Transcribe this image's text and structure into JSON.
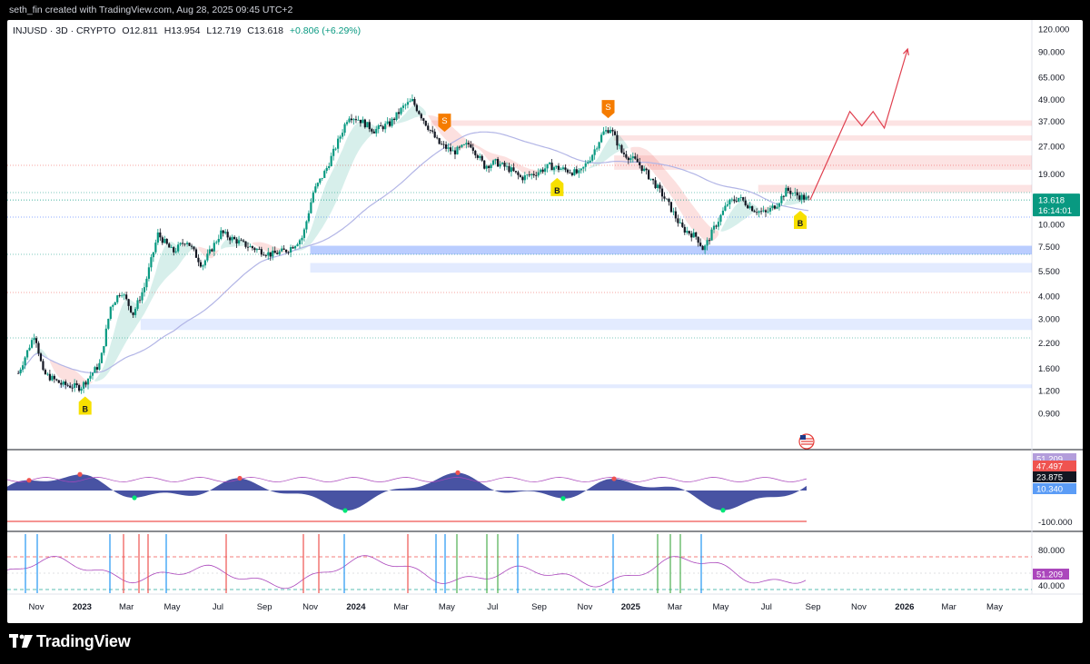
{
  "header": {
    "caption": "seth_fin created with TradingView.com, Aug 28, 2025 09:45 UTC+2"
  },
  "legend": {
    "symbol": "INJUSD · 3D · CRYPTO",
    "open": "O12.811",
    "high": "H13.954",
    "low": "L12.719",
    "close": "C13.618",
    "change": "+0.806 (+6.29%)"
  },
  "footer": {
    "brand": "TradingView"
  },
  "chart_data": [
    {
      "type": "candlestick",
      "symbol": "INJUSD",
      "interval": "3D",
      "scale": "log",
      "y_ticks": [
        "120.000",
        "90.000",
        "65.000",
        "49.000",
        "37.000",
        "27.000",
        "19.000",
        "10.000",
        "7.500",
        "5.500",
        "4.000",
        "3.000",
        "2.200",
        "1.600",
        "1.200",
        "0.900"
      ],
      "y_tick_values": [
        120,
        90,
        65,
        49,
        37,
        27,
        19,
        10,
        7.5,
        5.5,
        4,
        3,
        2.2,
        1.6,
        1.2,
        0.9
      ],
      "x_ticks": [
        "Nov",
        "2023",
        "Mar",
        "May",
        "Jul",
        "Sep",
        "Nov",
        "2024",
        "Mar",
        "May",
        "Jul",
        "Sep",
        "Nov",
        "2025",
        "Mar",
        "May",
        "Jul",
        "Sep",
        "Nov",
        "2026",
        "Mar",
        "May"
      ],
      "x_tick_dates": [
        "2022-11-01",
        "2023-01-01",
        "2023-03-01",
        "2023-05-01",
        "2023-07-01",
        "2023-09-01",
        "2023-11-01",
        "2024-01-01",
        "2024-03-01",
        "2024-05-01",
        "2024-07-01",
        "2024-09-01",
        "2024-11-01",
        "2025-01-01",
        "2025-03-01",
        "2025-05-01",
        "2025-07-01",
        "2025-09-01",
        "2025-11-01",
        "2026-01-01",
        "2026-03-01",
        "2026-05-01"
      ],
      "last_price": "13.618",
      "countdown": "16:14:01",
      "price_path": [
        [
          "2022-10-08",
          1.5
        ],
        [
          "2022-10-30",
          2.5
        ],
        [
          "2022-11-10",
          1.5
        ],
        [
          "2022-12-05",
          1.3
        ],
        [
          "2022-12-30",
          1.25
        ],
        [
          "2023-01-25",
          1.7
        ],
        [
          "2023-02-08",
          3.5
        ],
        [
          "2023-02-22",
          4.3
        ],
        [
          "2023-03-10",
          3.2
        ],
        [
          "2023-03-25",
          4.5
        ],
        [
          "2023-04-12",
          8.8
        ],
        [
          "2023-05-02",
          7.0
        ],
        [
          "2023-05-20",
          8.2
        ],
        [
          "2023-06-10",
          5.9
        ],
        [
          "2023-07-05",
          9.0
        ],
        [
          "2023-07-20",
          8.3
        ],
        [
          "2023-08-12",
          7.5
        ],
        [
          "2023-09-10",
          6.8
        ],
        [
          "2023-10-02",
          7.2
        ],
        [
          "2023-10-22",
          8.5
        ],
        [
          "2023-11-05",
          15
        ],
        [
          "2023-11-22",
          20
        ],
        [
          "2023-12-10",
          30
        ],
        [
          "2023-12-22",
          40
        ],
        [
          "2024-01-05",
          38
        ],
        [
          "2024-01-25",
          33
        ],
        [
          "2024-02-15",
          36
        ],
        [
          "2024-03-05",
          45
        ],
        [
          "2024-03-16",
          48
        ],
        [
          "2024-04-05",
          35
        ],
        [
          "2024-04-20",
          28
        ],
        [
          "2024-05-10",
          25
        ],
        [
          "2024-06-01",
          28
        ],
        [
          "2024-06-20",
          21
        ],
        [
          "2024-07-05",
          22
        ],
        [
          "2024-07-25",
          20
        ],
        [
          "2024-08-08",
          18
        ],
        [
          "2024-08-25",
          19
        ],
        [
          "2024-09-15",
          21
        ],
        [
          "2024-10-05",
          20
        ],
        [
          "2024-10-25",
          19
        ],
        [
          "2024-11-10",
          24
        ],
        [
          "2024-11-25",
          32
        ],
        [
          "2024-12-05",
          34
        ],
        [
          "2024-12-20",
          25
        ],
        [
          "2025-01-10",
          22
        ],
        [
          "2025-02-01",
          17
        ],
        [
          "2025-02-20",
          13
        ],
        [
          "2025-03-10",
          9.5
        ],
        [
          "2025-03-30",
          8.5
        ],
        [
          "2025-04-08",
          7.2
        ],
        [
          "2025-04-22",
          9.5
        ],
        [
          "2025-05-10",
          13
        ],
        [
          "2025-05-25",
          14
        ],
        [
          "2025-06-15",
          12
        ],
        [
          "2025-06-30",
          11.5
        ],
        [
          "2025-07-15",
          13
        ],
        [
          "2025-07-28",
          15.5
        ],
        [
          "2025-08-10",
          14.5
        ],
        [
          "2025-08-28",
          13.6
        ]
      ],
      "projection_path": [
        [
          "2025-08-28",
          13.6
        ],
        [
          "2025-10-20",
          42
        ],
        [
          "2025-11-05",
          35
        ],
        [
          "2025-11-20",
          42
        ],
        [
          "2025-12-05",
          34
        ],
        [
          "2026-01-05",
          93
        ]
      ],
      "signals": [
        {
          "label": "S",
          "date": "2024-04-28",
          "side": "sell"
        },
        {
          "label": "S",
          "date": "2024-12-02",
          "side": "sell"
        },
        {
          "label": "B",
          "date": "2023-01-05",
          "side": "buy"
        },
        {
          "label": "B",
          "date": "2024-09-25",
          "side": "buy"
        },
        {
          "label": "B",
          "date": "2025-08-15",
          "side": "buy"
        }
      ],
      "zones": [
        {
          "from_date": "2024-04-10",
          "lo": 35,
          "hi": 37.5,
          "color": "red"
        },
        {
          "from_date": "2024-12-10",
          "lo": 29,
          "hi": 31,
          "color": "red"
        },
        {
          "from_date": "2024-12-10",
          "lo": 20,
          "hi": 24,
          "color": "red"
        },
        {
          "from_date": "2025-06-20",
          "lo": 15,
          "hi": 16.5,
          "color": "red"
        },
        {
          "from_date": "2023-11-01",
          "lo": 6.8,
          "hi": 7.6,
          "color": "blue"
        },
        {
          "from_date": "2023-11-01",
          "lo": 5.4,
          "hi": 6.1,
          "color": "blue-light"
        },
        {
          "from_date": "2023-03-20",
          "lo": 2.6,
          "hi": 3.0,
          "color": "blue-light"
        },
        {
          "from_date": "2022-12-01",
          "lo": 1.24,
          "hi": 1.3,
          "color": "blue-light"
        }
      ],
      "colors": {
        "up": "#089981",
        "down": "#131722",
        "ma": "#b2b5e6",
        "projection": "#e0404f",
        "buy": "#f7e000",
        "sell": "#f57c00"
      }
    },
    {
      "type": "area",
      "name": "oscillator",
      "y_ticks": [
        "-100.000"
      ],
      "value_labels": [
        {
          "text": "51.209",
          "bg": "#b39ddb",
          "fg": "#ffffff"
        },
        {
          "text": "47.497",
          "bg": "#ef5350",
          "fg": "#ffffff"
        },
        {
          "text": "23.875",
          "bg": "#131722",
          "fg": "#ffffff"
        },
        {
          "text": "10.340",
          "bg": "#5b9cf6",
          "fg": "#ffffff"
        }
      ]
    },
    {
      "type": "line",
      "name": "rsi",
      "y_ticks": [
        "80.000",
        "40.000"
      ],
      "value_labels": [
        {
          "text": "51.209",
          "bg": "#ab47bc",
          "fg": "#ffffff"
        }
      ],
      "levels": [
        70,
        30
      ]
    }
  ]
}
